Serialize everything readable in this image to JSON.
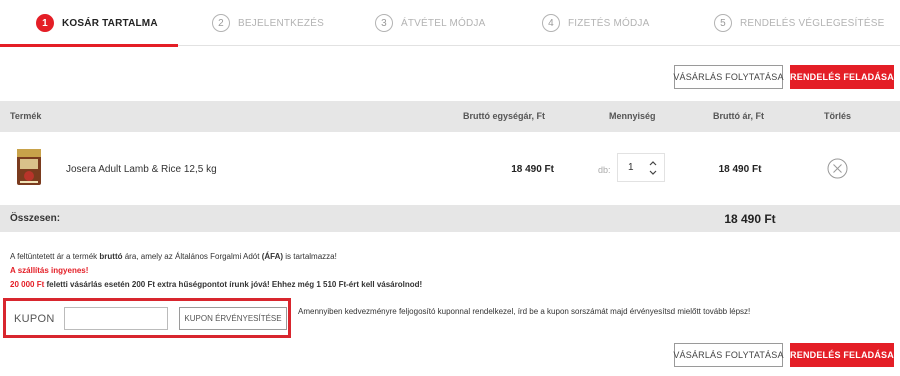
{
  "steps": [
    {
      "num": "1",
      "label": "KOSÁR TARTALMA",
      "active": true
    },
    {
      "num": "2",
      "label": "BEJELENTKEZÉS",
      "active": false
    },
    {
      "num": "3",
      "label": "ÁTVÉTEL MÓDJA",
      "active": false
    },
    {
      "num": "4",
      "label": "FIZETÉS MÓDJA",
      "active": false
    },
    {
      "num": "5",
      "label": "RENDELÉS VÉGLEGESÍTÉSE",
      "active": false
    }
  ],
  "actions": {
    "continue_label": "VÁSÁRLÁS FOLYTATÁSA",
    "order_label": "RENDELÉS FELADÁSA"
  },
  "table": {
    "headers": {
      "product": "Termék",
      "unit_price": "Bruttó egységár, Ft",
      "quantity": "Mennyiség",
      "line_price": "Bruttó ár, Ft",
      "delete": "Törlés"
    },
    "rows": [
      {
        "name": "Josera Adult Lamb & Rice 12,5 kg",
        "unit_price": "18 490 Ft",
        "qty_prefix": "db:",
        "qty": "1",
        "line_price": "18 490 Ft"
      }
    ]
  },
  "total": {
    "label": "Összesen:",
    "value": "18 490 Ft"
  },
  "notes": {
    "vat_1": "A feltüntetett ár a termék",
    "vat_bold1": "bruttó",
    "vat_2": "ára, amely az Általános Forgalmi Adót",
    "vat_bold2": "(ÁFA)",
    "vat_3": "is tartalmazza!",
    "shipping": "A szállítás ingyenes!",
    "loyalty_red": "20 000 Ft",
    "loyalty_rest": "feletti vásárlás esetén 200 Ft extra hűségpontot írunk jóvá! Ehhez még 1 510 Ft-ért kell vásárolnod!"
  },
  "coupon": {
    "label": "KUPON",
    "input_value": "",
    "button_label": "KUPON ÉRVÉNYESÍTÉSE",
    "help": "Amennyiben kedvezményre feljogosító kuponnal rendelkezel, írd be a kupon sorszámát majd érvényesítsd mielőtt tovább lépsz!"
  },
  "colors": {
    "accent": "#e41e26",
    "header_bg": "#e6e6e6"
  }
}
